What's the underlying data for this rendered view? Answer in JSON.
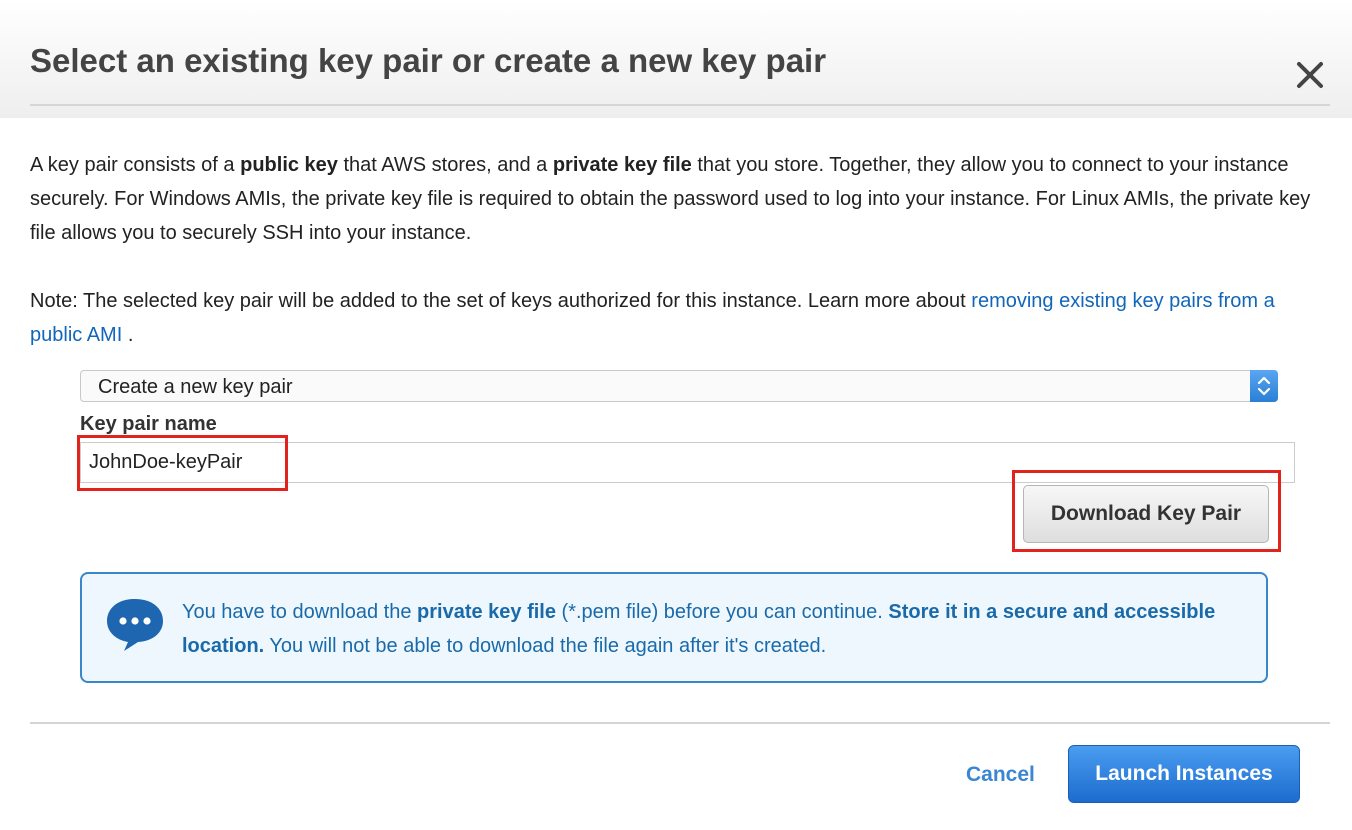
{
  "dialog": {
    "title": "Select an existing key pair or create a new key pair"
  },
  "description": {
    "part1": "A key pair consists of a ",
    "bold1": "public key",
    "part2": " that AWS stores, and a ",
    "bold2": "private key file",
    "part3": " that you store. Together, they allow you to connect to your instance securely. For Windows AMIs, the private key file is required to obtain the password used to log into your instance. For Linux AMIs, the private key file allows you to securely SSH into your instance."
  },
  "note": {
    "text": "Note: The selected key pair will be added to the set of keys authorized for this instance. Learn more about ",
    "link": "removing existing key pairs from a public AMI",
    "end": " ."
  },
  "key_pair": {
    "select_value": "Create a new key pair",
    "name_label": "Key pair name",
    "name_value": "JohnDoe-keyPair",
    "download_label": "Download Key Pair"
  },
  "info": {
    "part1": "You have to download the ",
    "bold1": "private key file",
    "part2": " (*.pem file) before you can continue. ",
    "bold2": "Store it in a secure and accessible location.",
    "part3": " You will not be able to download the file again after it's created."
  },
  "footer": {
    "cancel_label": "Cancel",
    "launch_label": "Launch Instances"
  },
  "colors": {
    "link": "#1166bb",
    "primary_button": "#1c6ccf",
    "highlight": "#e0231c",
    "info_text": "#1a6aaa"
  }
}
